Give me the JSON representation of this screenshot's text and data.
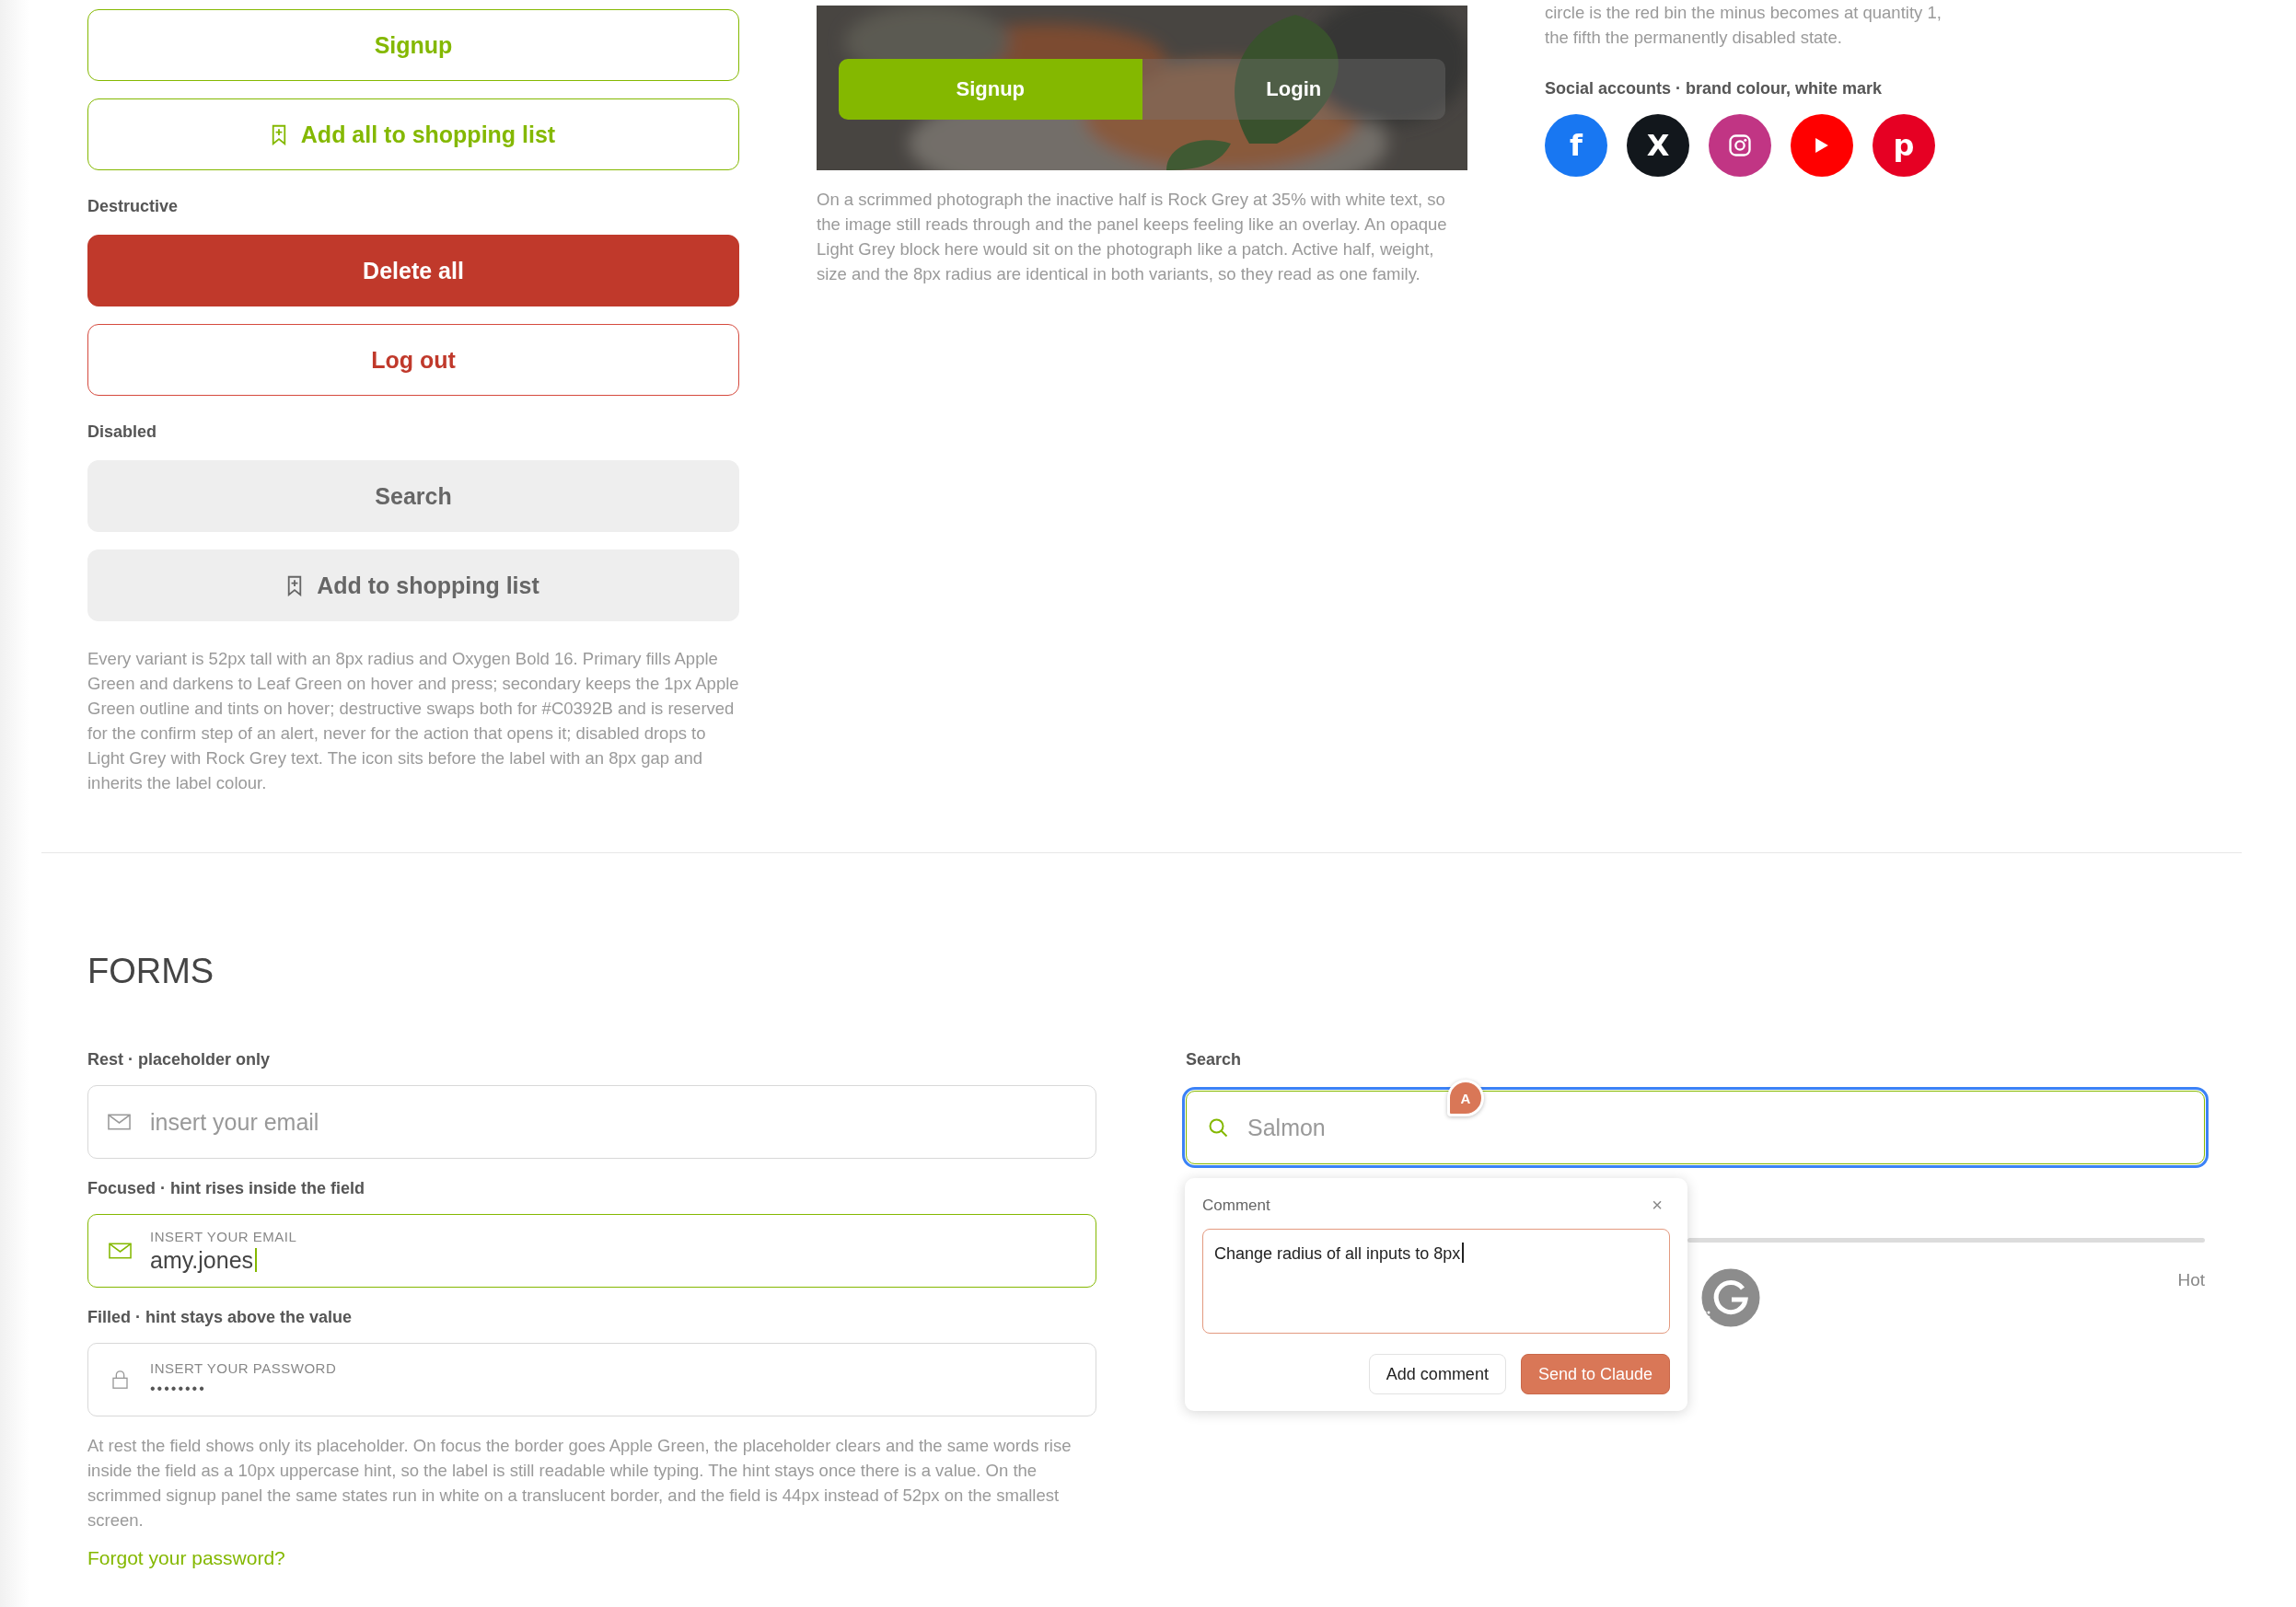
{
  "buttons_column": {
    "items": [
      {
        "kind": "secondary",
        "label": "Signup",
        "bookmark_icon": false
      },
      {
        "kind": "secondary",
        "label": "Add all to shopping list",
        "bookmark_icon": true
      },
      {
        "kind": "heading",
        "text": "Destructive"
      },
      {
        "kind": "destructive",
        "label": "Delete all",
        "bookmark_icon": false
      },
      {
        "kind": "destructive_outline",
        "label": "Log out",
        "bookmark_icon": false
      },
      {
        "kind": "heading",
        "text": "Disabled"
      },
      {
        "kind": "disabled",
        "label": "Search",
        "bookmark_icon": false
      },
      {
        "kind": "disabled",
        "label": "Add to shopping list",
        "bookmark_icon": true
      },
      {
        "kind": "note",
        "text": "Every variant is 52px tall with an 8px radius and Oxygen Bold 16. Primary fills Apple Green and darkens to Leaf Green on hover and press; secondary keeps the 1px Apple Green outline and tints on hover; destructive swaps both for #C0392B and is reserved for the confirm step of an alert, never for the action that opens it; disabled drops to Light Grey with Rock Grey text. The icon sits before the label with an 8px gap and inherits the label colour."
      }
    ]
  },
  "scrim_panel": {
    "toggle": [
      {
        "label": "Signup",
        "selected": true
      },
      {
        "label": "Login",
        "selected": false
      }
    ],
    "note": "On a scrimmed photograph the inactive half is Rock Grey at 35% with white text, so the image still reads through and the panel keeps feeling like an overlay. An opaque Light Grey block here would sit on the photograph like a patch. Active half, weight, size and the 8px radius are identical in both variants, so they read as one family."
  },
  "social_column": {
    "note": "circle is the red bin the minus becomes at quantity 1, the fifth the permanently disabled state.",
    "heading": "Social accounts · brand colour, white mark",
    "accounts": [
      {
        "kind": "glyph",
        "glyph": "f",
        "color": "#1877f2"
      },
      {
        "kind": "glyph",
        "glyph": "X",
        "color": "#12171c"
      },
      {
        "kind": "camera",
        "color": "#c13584"
      },
      {
        "kind": "play",
        "color": "#ff0000"
      },
      {
        "kind": "glyph",
        "glyph": "p",
        "color": "#e60023"
      }
    ]
  },
  "forms": {
    "title": "FORMS",
    "fields": [
      {
        "label": "Rest · placeholder only",
        "kind": "rest",
        "placeholder": "insert your email"
      },
      {
        "label": "Focused · hint rises inside the field",
        "kind": "focused",
        "hint": "INSERT YOUR EMAIL",
        "value": "amy.jones"
      },
      {
        "label": "Filled · hint stays above the value",
        "kind": "filled",
        "hint": "INSERT YOUR PASSWORD",
        "value": "••••••••"
      }
    ],
    "note": "At rest the field shows only its placeholder. On focus the border goes Apple Green, the placeholder clears and the same words rise inside the field as a 10px uppercase hint, so the label is still readable while typing. The hint stays once there is a value. On the scrimmed signup panel the same states run in white on a translucent border, and the field is 44px instead of 52px on the smallest screen.",
    "link": "Forgot your password?",
    "search": {
      "label": "Search",
      "placeholder": "Salmon",
      "focused": true,
      "highlighted": true
    },
    "slider": {
      "end_label": "Hot"
    }
  },
  "comment_overlay": {
    "marker": "A",
    "title": "Comment",
    "close": "×",
    "text": "Change radius of all inputs to 8px",
    "caret": true,
    "buttons": [
      {
        "label": "Add comment",
        "kind": "plain"
      },
      {
        "label": "Send to Claude",
        "kind": "primary"
      }
    ]
  }
}
